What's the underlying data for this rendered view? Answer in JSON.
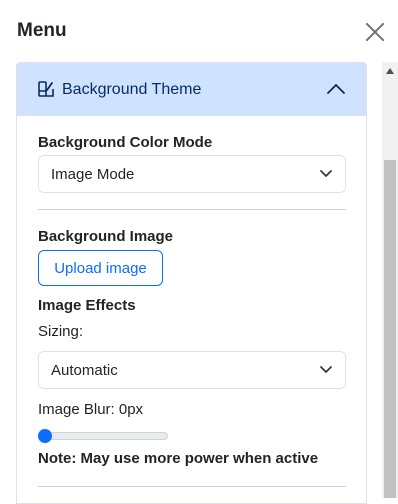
{
  "menu": {
    "title": "Menu"
  },
  "accordion": {
    "title": "Background Theme"
  },
  "background_color_mode": {
    "label": "Background Color Mode",
    "selected": "Image Mode"
  },
  "background_image": {
    "label": "Background Image",
    "upload_label": "Upload image"
  },
  "image_effects": {
    "label": "Image Effects",
    "sizing_label": "Sizing:",
    "sizing_selected": "Automatic",
    "blur_label": "Image Blur: 0px",
    "blur_value": 0,
    "note": "Note: May use more power when active"
  },
  "icons": {
    "close": "close-icon",
    "theme": "palette-brush-icon",
    "collapse": "chevron-up-icon",
    "select": "chevron-down-icon"
  },
  "colors": {
    "accent": "#0d6efd",
    "header_bg": "#cfe2ff",
    "header_text": "#052c65"
  }
}
